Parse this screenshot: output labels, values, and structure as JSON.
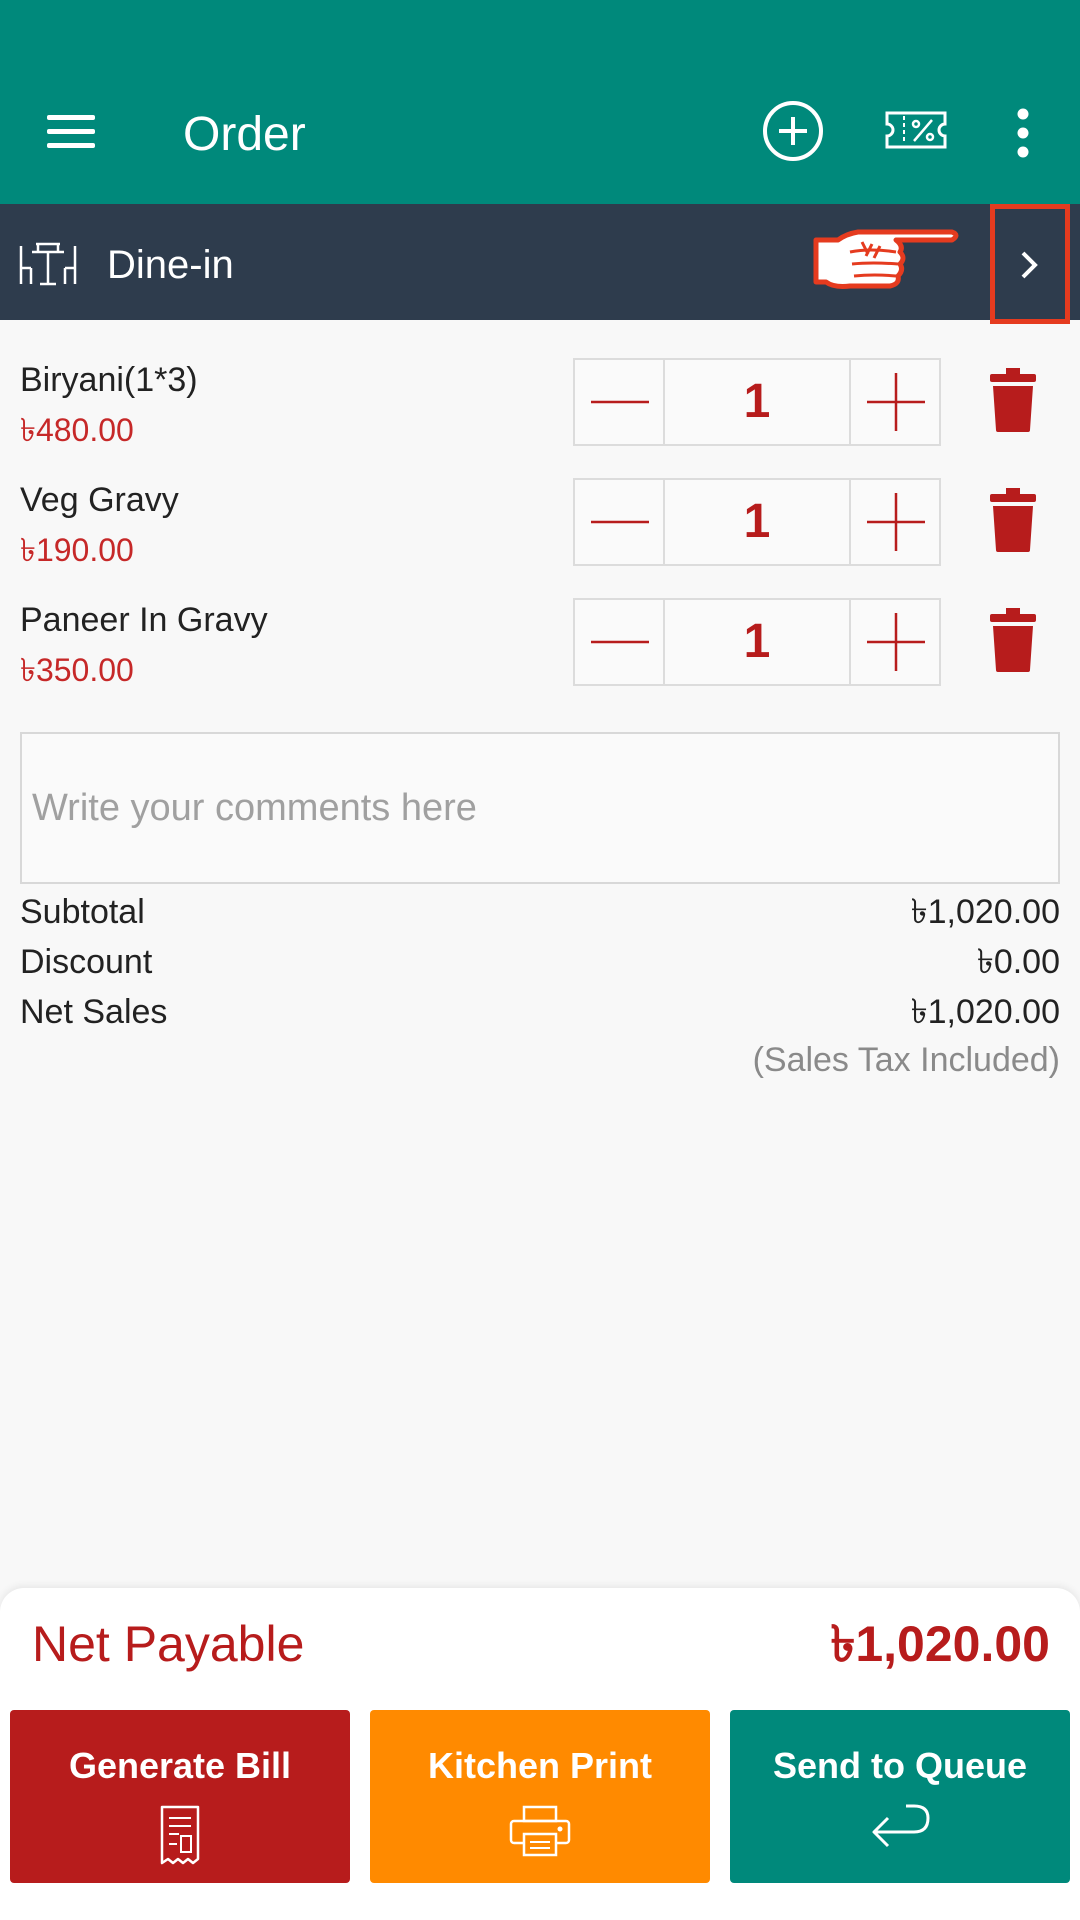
{
  "appbar": {
    "title": "Order",
    "icons": [
      "menu-icon",
      "add-circle-icon",
      "discount-ticket-icon",
      "more-vert-icon"
    ]
  },
  "order_type": {
    "label": "Dine-in",
    "icons": [
      "table-icon",
      "pointing-hand-icon",
      "chevron-right-icon"
    ]
  },
  "items": [
    {
      "name": "Biryani(1*3)",
      "price": "৳480.00",
      "qty": "1"
    },
    {
      "name": "Veg Gravy",
      "price": "৳190.00",
      "qty": "1"
    },
    {
      "name": "Paneer In Gravy",
      "price": "৳350.00",
      "qty": "1"
    }
  ],
  "comment": {
    "placeholder": "Write your comments here",
    "value": ""
  },
  "totals": {
    "subtotal_label": "Subtotal",
    "subtotal": "৳1,020.00",
    "discount_label": "Discount",
    "discount": "৳0.00",
    "net_sales_label": "Net Sales",
    "net_sales": "৳1,020.00",
    "tax_note": "(Sales Tax Included)"
  },
  "net_payable": {
    "label": "Net Payable",
    "value": "৳1,020.00"
  },
  "actions": {
    "generate_bill": "Generate Bill",
    "kitchen_print": "Kitchen Print",
    "send_to_queue": "Send to Queue"
  },
  "colors": {
    "appbar": "#00897b",
    "typebar": "#2e3c4d",
    "accent_red": "#b71c1c",
    "kitchen_orange": "#ff8a00",
    "highlight_box": "#e53b1f"
  }
}
